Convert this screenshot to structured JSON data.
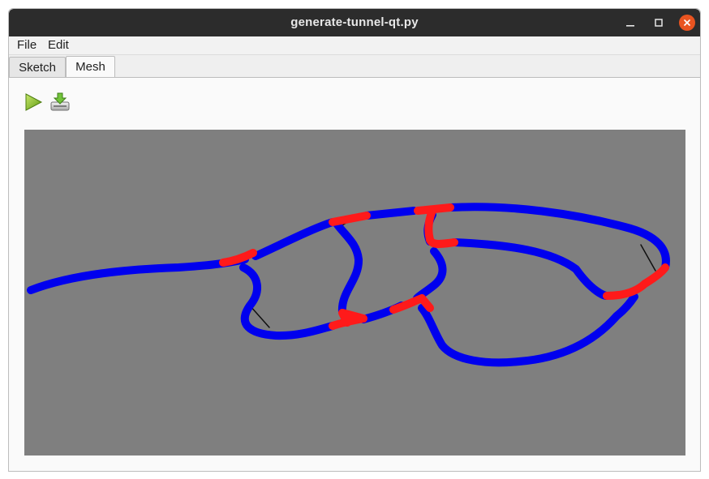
{
  "window": {
    "title": "generate-tunnel-qt.py"
  },
  "menu": {
    "items": [
      {
        "label": "File"
      },
      {
        "label": "Edit"
      }
    ]
  },
  "tabs": [
    {
      "label": "Sketch",
      "active": false
    },
    {
      "label": "Mesh",
      "active": true
    }
  ],
  "toolbar": {
    "run_icon": "play-icon",
    "save_icon": "download-save-icon"
  },
  "viewport": {
    "background_color": "#7f7f7f",
    "tunnel_color": "#0000ee",
    "junction_color": "#ff1a1a"
  }
}
